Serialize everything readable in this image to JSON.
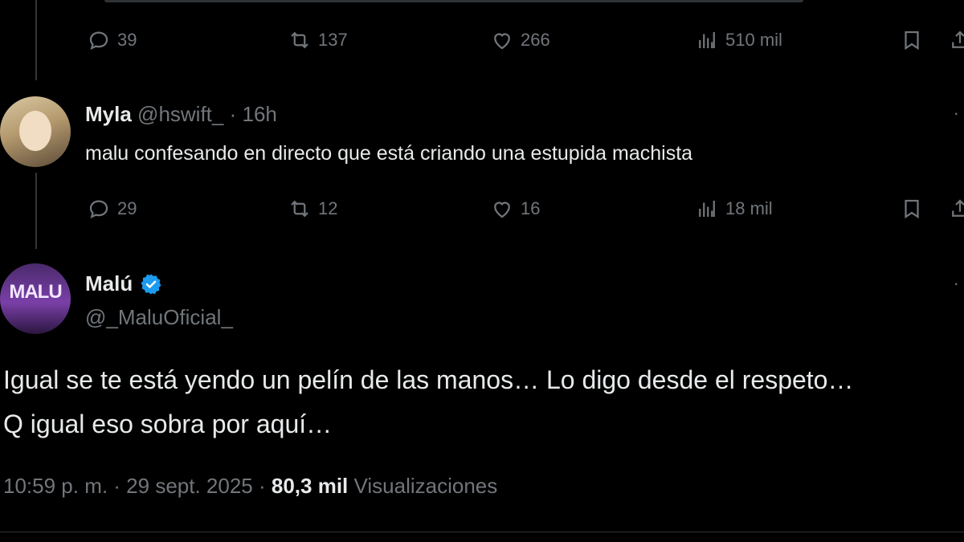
{
  "tweet1": {
    "replies": "39",
    "retweets": "137",
    "likes": "266",
    "views": "510 mil"
  },
  "tweet2": {
    "name": "Myla",
    "handle": "@hswift_",
    "time": "· 16h",
    "text": "malu confesando en directo que está criando una estupida machista",
    "replies": "29",
    "retweets": "12",
    "likes": "16",
    "views": "18 mil"
  },
  "tweet3": {
    "name": "Malú",
    "handle": "@_MaluOficial_",
    "avatar_text": "MALU",
    "text_line1": "Igual se te está yendo un pelín de las manos… Lo digo desde el respeto…",
    "text_line2": "Q igual eso sobra por aquí…",
    "timestamp": "10:59 p. m. · 29 sept. 2025 ·",
    "views_count": "80,3 mil",
    "views_label": "Visualizaciones"
  },
  "colors": {
    "background": "#000000",
    "text": "#e7e9ea",
    "muted": "#71767b",
    "verified": "#1d9bf0"
  }
}
